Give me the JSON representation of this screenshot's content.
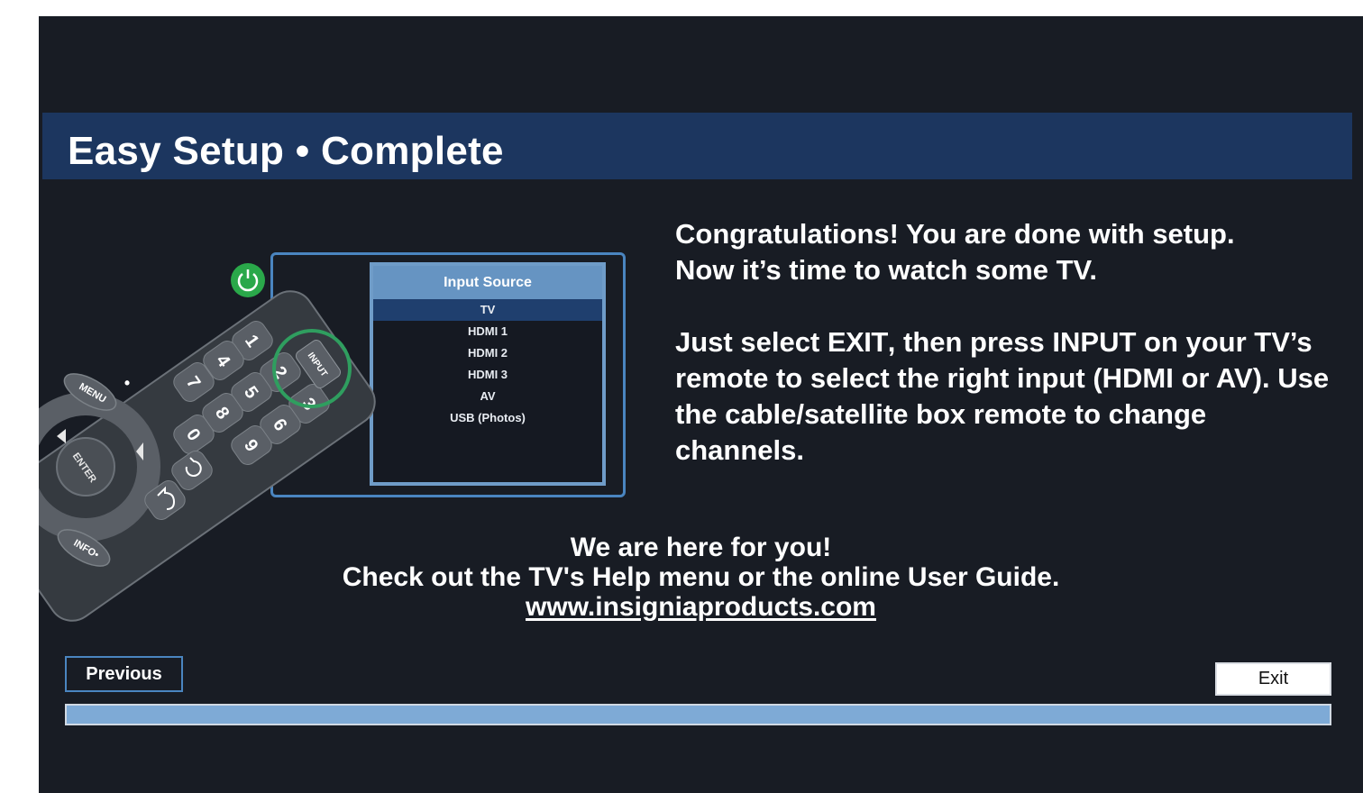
{
  "colors": {
    "background": "#181c24",
    "title_bar": "#1c365f",
    "accent_blue": "#4a85c0",
    "menu_header": "#6694c2",
    "progress_fill": "#7eaad6",
    "input_highlight": "#2f9e5f",
    "power_green": "#2aa84a"
  },
  "header": {
    "title": "Easy Setup • Complete"
  },
  "illustration": {
    "input_menu": {
      "title": "Input Source",
      "items": [
        "TV",
        "HDMI 1",
        "HDMI 2",
        "HDMI 3",
        "AV",
        "USB (Photos)"
      ],
      "selected_index": 0
    },
    "remote": {
      "number_keys": [
        "1",
        "2",
        "3",
        "4",
        "5",
        "6",
        "7",
        "8",
        "9",
        "0"
      ],
      "labels": {
        "menu": "MENU",
        "enter": "ENTER",
        "info": "INFO•",
        "input": "INPUT",
        "dot": "•"
      },
      "icons": [
        "power-icon",
        "back-icon",
        "return-icon",
        "dpad-arrow-icon"
      ]
    }
  },
  "message": {
    "line1": "Congratulations! You are done with setup.",
    "line2": "Now it’s time to watch some TV.",
    "para2_before": "Just select ",
    "para2_bold": "EXIT",
    "para2_after": ", then press INPUT on your TV’s remote to select the right input (HDMI or AV). Use the cable/satellite box remote to change channels."
  },
  "help": {
    "line1": "We are here for you!",
    "line2": "Check out the TV's Help menu or the online User Guide.",
    "link": "www.insigniaproducts.com"
  },
  "buttons": {
    "previous": "Previous",
    "exit": "Exit"
  },
  "progress": {
    "fraction": 1.0
  }
}
